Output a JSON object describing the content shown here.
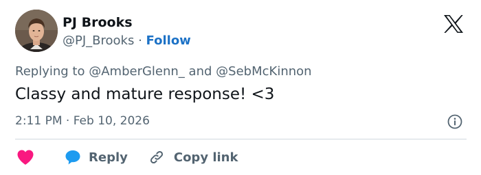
{
  "author": {
    "name": "PJ Brooks",
    "handle": "@PJ_Brooks",
    "separator": "·",
    "follow_label": "Follow"
  },
  "reply": {
    "prefix": "Replying to",
    "mentions": [
      "@AmberGlenn_",
      "@SebMcKinnon"
    ],
    "conjunction": "and"
  },
  "tweet": {
    "text": "Classy and mature response! <3",
    "timestamp": "2:11 PM · Feb 10, 2026"
  },
  "actions": {
    "reply_label": "Reply",
    "copy_link_label": "Copy link"
  },
  "icons": {
    "logo": "x-logo-icon",
    "info": "info-icon",
    "like": "heart-icon",
    "reply": "speech-bubble-icon",
    "copy": "link-icon"
  },
  "colors": {
    "text": "#0f1419",
    "secondary": "#536471",
    "follow": "#1d72c6",
    "heart": "#f91880",
    "bubble": "#1d9bf0",
    "divider": "#cfd9de"
  }
}
